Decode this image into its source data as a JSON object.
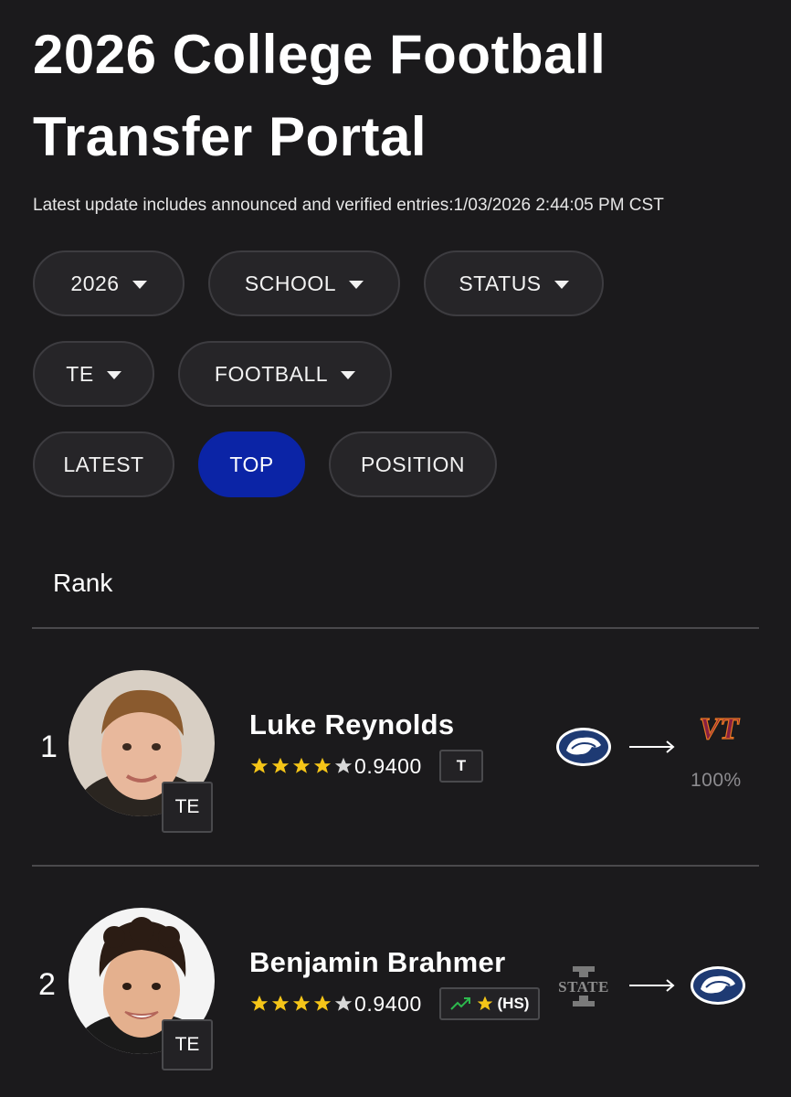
{
  "header": {
    "title_line1": "2026 College Football",
    "title_line2": "Transfer Portal",
    "update_text": "Latest update includes announced and verified entries:1/03/2026 2:44:05 PM CST"
  },
  "filters": {
    "year": "2026",
    "school": "SCHOOL",
    "status": "STATUS",
    "position": "TE",
    "sport": "FOOTBALL"
  },
  "sort_tabs": {
    "latest": "LATEST",
    "top": "TOP",
    "position": "POSITION",
    "active": "TOP"
  },
  "table": {
    "rank_header": "Rank"
  },
  "players": [
    {
      "rank": "1",
      "name": "Luke Reynolds",
      "position": "TE",
      "stars": 4,
      "rating": "0.9400",
      "tag": "T",
      "from_logo": "penn-state-logo",
      "to_logo": "virginia-tech-logo",
      "to_logo_text": "VT",
      "commit_pct": "100%"
    },
    {
      "rank": "2",
      "name": "Benjamin Brahmer",
      "position": "TE",
      "stars": 4,
      "rating": "0.9400",
      "tag": "(HS)",
      "from_logo": "iowa-state-logo",
      "from_logo_text": "STATE",
      "to_logo": "penn-state-logo"
    }
  ],
  "colors": {
    "background": "#1b1a1c",
    "active_tab": "#0b24a6",
    "star": "#f5c518",
    "trend_up": "#2db84d",
    "vt_maroon": "#861f41",
    "psu_navy": "#1e3a73"
  }
}
